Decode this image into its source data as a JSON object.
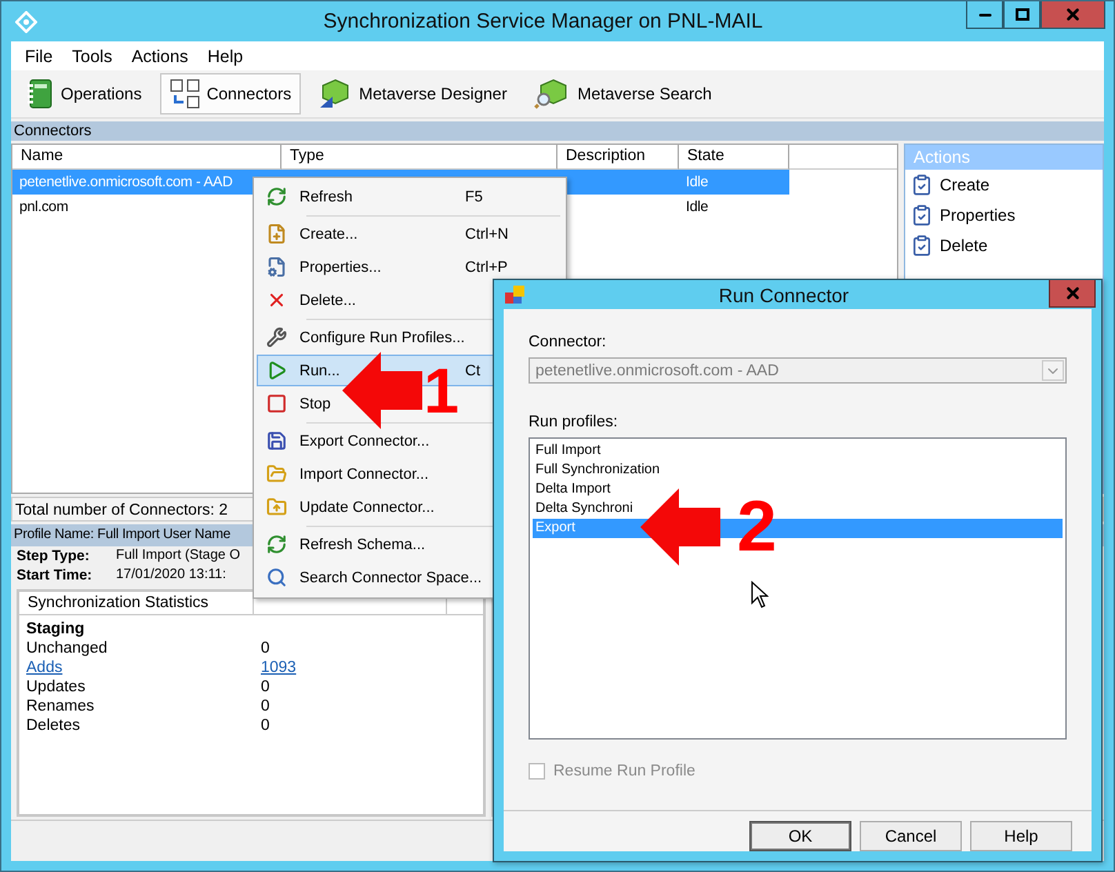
{
  "window": {
    "title": "Synchronization Service Manager on PNL-MAIL"
  },
  "menu_bar": [
    "File",
    "Tools",
    "Actions",
    "Help"
  ],
  "toolbar": [
    {
      "label": "Operations",
      "selected": false
    },
    {
      "label": "Connectors",
      "selected": true
    },
    {
      "label": "Metaverse Designer",
      "selected": false
    },
    {
      "label": "Metaverse Search",
      "selected": false
    }
  ],
  "connectors_panel": {
    "title": "Connectors",
    "columns": [
      "Name",
      "Type",
      "Description",
      "State"
    ],
    "rows": [
      {
        "name": "petenetlive.onmicrosoft.com - AAD",
        "state": "Idle",
        "selected": true
      },
      {
        "name": "pnl.com",
        "state": "Idle",
        "selected": false
      }
    ],
    "total": "Total number of Connectors: 2"
  },
  "actions_panel": {
    "title": "Actions",
    "items": [
      "Create",
      "Properties",
      "Delete"
    ]
  },
  "run_details": {
    "profile_bar": "Profile Name: Full Import  User Name",
    "fields": [
      {
        "label": "Step Type:",
        "value": "Full Import (Stage O"
      },
      {
        "label": "Start Time:",
        "value": "17/01/2020 13:11:"
      }
    ],
    "stats": {
      "header": "Synchronization Statistics",
      "section": "Staging",
      "rows": [
        {
          "label": "Unchanged",
          "value": "0",
          "link": false
        },
        {
          "label": "Adds",
          "value": "1093",
          "link": true
        },
        {
          "label": "Updates",
          "value": "0",
          "link": false
        },
        {
          "label": "Renames",
          "value": "0",
          "link": false
        },
        {
          "label": "Deletes",
          "value": "0",
          "link": false
        }
      ]
    }
  },
  "context_menu": {
    "items": [
      {
        "label": "Refresh",
        "shortcut": "F5",
        "selected": false,
        "separator_after": true
      },
      {
        "label": "Create...",
        "shortcut": "Ctrl+N",
        "selected": false,
        "separator_after": false
      },
      {
        "label": "Properties...",
        "shortcut": "Ctrl+P",
        "selected": false,
        "separator_after": false
      },
      {
        "label": "Delete...",
        "selected": false,
        "separator_after": true
      },
      {
        "label": "Configure Run Profiles...",
        "selected": false,
        "separator_after": false
      },
      {
        "label": "Run...",
        "shortcut": "Ct",
        "selected": true,
        "separator_after": false
      },
      {
        "label": "Stop",
        "selected": false,
        "separator_after": true
      },
      {
        "label": "Export Connector...",
        "selected": false,
        "separator_after": false
      },
      {
        "label": "Import Connector...",
        "selected": false,
        "separator_after": false
      },
      {
        "label": "Update Connector...",
        "selected": false,
        "separator_after": true
      },
      {
        "label": "Refresh Schema...",
        "selected": false,
        "separator_after": false
      },
      {
        "label": "Search Connector Space...",
        "selected": false,
        "separator_after": false
      }
    ]
  },
  "dialog": {
    "title": "Run Connector",
    "connector_label": "Connector:",
    "connector_value": "petenetlive.onmicrosoft.com - AAD",
    "profiles_label": "Run profiles:",
    "profiles": [
      {
        "label": "Full Import",
        "selected": false
      },
      {
        "label": "Full Synchronization",
        "selected": false
      },
      {
        "label": "Delta Import",
        "selected": false
      },
      {
        "label": "Delta Synchroni",
        "selected": false
      },
      {
        "label": "Export",
        "selected": true
      }
    ],
    "resume": {
      "label": "Resume Run Profile",
      "checked": false,
      "disabled": true
    },
    "buttons": [
      "OK",
      "Cancel",
      "Help"
    ]
  },
  "annotations": [
    {
      "number": "1"
    },
    {
      "number": "2"
    }
  ]
}
